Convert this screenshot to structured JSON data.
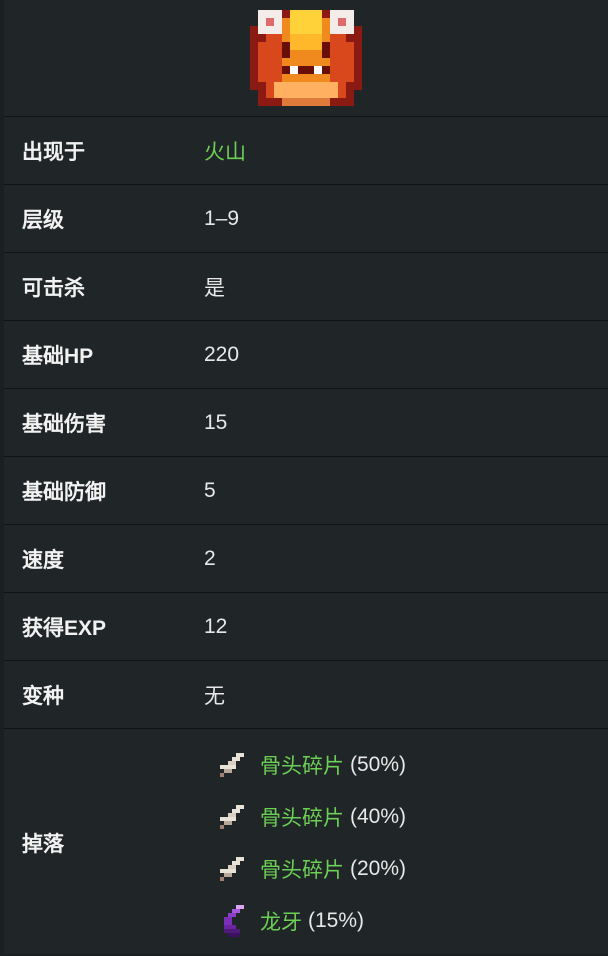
{
  "creature": {
    "sprite_icon": "magma-sprite-icon",
    "colors": {
      "accent_green": "#6ccf56"
    }
  },
  "stats": [
    {
      "label": "出现于",
      "value": "火山",
      "link": true
    },
    {
      "label": "层级",
      "value": "1–9",
      "link": false
    },
    {
      "label": "可击杀",
      "value": "是",
      "link": false
    },
    {
      "label": "基础HP",
      "value": "220",
      "link": false
    },
    {
      "label": "基础伤害",
      "value": "15",
      "link": false
    },
    {
      "label": "基础防御",
      "value": "5",
      "link": false
    },
    {
      "label": "速度",
      "value": "2",
      "link": false
    },
    {
      "label": "获得EXP",
      "value": "12",
      "link": false
    },
    {
      "label": "变种",
      "value": "无",
      "link": false
    }
  ],
  "drops": {
    "label": "掉落",
    "items": [
      {
        "name": "骨头碎片",
        "chance": "(50%)",
        "icon": "bone-fragment-icon"
      },
      {
        "name": "骨头碎片",
        "chance": "(40%)",
        "icon": "bone-fragment-icon"
      },
      {
        "name": "骨头碎片",
        "chance": "(20%)",
        "icon": "bone-fragment-icon"
      },
      {
        "name": "龙牙",
        "chance": "(15%)",
        "icon": "dragon-tooth-icon"
      }
    ]
  }
}
